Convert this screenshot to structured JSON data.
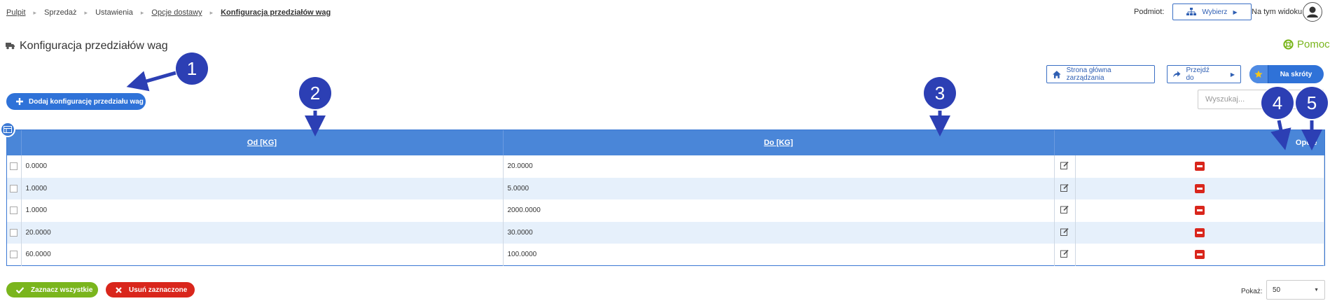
{
  "breadcrumb": {
    "items": [
      "Pulpit",
      "Sprzedaż",
      "Ustawienia",
      "Opcje dostawy",
      "Konfiguracja przedziałów wag"
    ],
    "separator": "▸"
  },
  "topbar": {
    "subject_label": "Podmiot:",
    "choose_label": "Wybierz",
    "view_label": "Na tym widoku"
  },
  "page": {
    "title": "Konfiguracja przedziałów wag",
    "help_label": "Pomoc"
  },
  "actions": {
    "home_label": "Strona główna zarządzania",
    "goto_label": "Przejdź do",
    "shortcuts_label": "Na skróty",
    "add_label": "Dodaj konfigurację przedziału wag"
  },
  "search": {
    "placeholder": "Wyszukaj...",
    "value": ""
  },
  "table": {
    "headers": {
      "from": "Od [KG]",
      "to": "Do [KG]",
      "options": "Opcje"
    },
    "rows": [
      {
        "from": "0.0000",
        "to": "20.0000"
      },
      {
        "from": "1.0000",
        "to": "5.0000"
      },
      {
        "from": "1.0000",
        "to": "2000.0000"
      },
      {
        "from": "20.0000",
        "to": "30.0000"
      },
      {
        "from": "60.0000",
        "to": "100.0000"
      }
    ]
  },
  "footer": {
    "select_all_label": "Zaznacz wszystkie",
    "delete_selected_label": "Usuń zaznaczone",
    "show_label": "Pokaż:",
    "page_size": "50"
  },
  "annotations": [
    "1",
    "2",
    "3",
    "4",
    "5"
  ],
  "colors": {
    "primary": "#2f72d8",
    "header_bg": "#4a86d8",
    "success": "#7ab51d",
    "danger": "#d9261c",
    "annotation": "#2c3fb4"
  }
}
